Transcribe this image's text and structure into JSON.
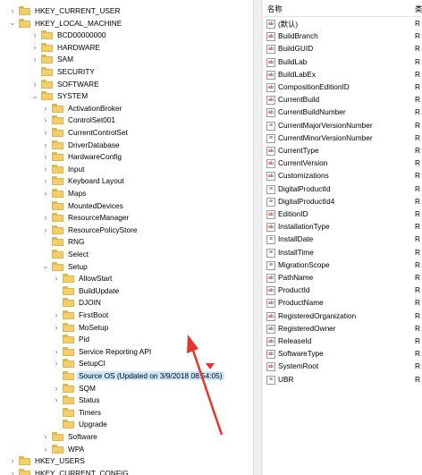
{
  "tree": [
    {
      "label": "HKEY_CURRENT_USER",
      "level": 0,
      "exp": ">",
      "name": "tree-item-hkey-current-user"
    },
    {
      "label": "HKEY_LOCAL_MACHINE",
      "level": 0,
      "exp": "v",
      "name": "tree-item-hkey-local-machine"
    },
    {
      "label": "BCD00000000",
      "level": 1,
      "exp": ">",
      "name": "tree-item-bcd00000000"
    },
    {
      "label": "HARDWARE",
      "level": 1,
      "exp": ">",
      "name": "tree-item-hardware"
    },
    {
      "label": "SAM",
      "level": 1,
      "exp": ">",
      "name": "tree-item-sam"
    },
    {
      "label": "SECURITY",
      "level": 1,
      "exp": "",
      "name": "tree-item-security"
    },
    {
      "label": "SOFTWARE",
      "level": 1,
      "exp": ">",
      "name": "tree-item-software"
    },
    {
      "label": "SYSTEM",
      "level": 1,
      "exp": "v",
      "name": "tree-item-system"
    },
    {
      "label": "ActivationBroker",
      "level": 2,
      "exp": ">",
      "name": "tree-item-activationbroker"
    },
    {
      "label": "ControlSet001",
      "level": 2,
      "exp": ">",
      "name": "tree-item-controlset001"
    },
    {
      "label": "CurrentControlSet",
      "level": 2,
      "exp": ">",
      "name": "tree-item-currentcontrolset"
    },
    {
      "label": "DriverDatabase",
      "level": 2,
      "exp": ">",
      "name": "tree-item-driverdatabase"
    },
    {
      "label": "HardwareConfig",
      "level": 2,
      "exp": ">",
      "name": "tree-item-hardwareconfig"
    },
    {
      "label": "Input",
      "level": 2,
      "exp": ">",
      "name": "tree-item-input"
    },
    {
      "label": "Keyboard Layout",
      "level": 2,
      "exp": ">",
      "name": "tree-item-keyboard-layout"
    },
    {
      "label": "Maps",
      "level": 2,
      "exp": ">",
      "name": "tree-item-maps"
    },
    {
      "label": "MountedDevices",
      "level": 2,
      "exp": "",
      "name": "tree-item-mounteddevices"
    },
    {
      "label": "ResourceManager",
      "level": 2,
      "exp": ">",
      "name": "tree-item-resourcemanager"
    },
    {
      "label": "ResourcePolicyStore",
      "level": 2,
      "exp": ">",
      "name": "tree-item-resourcepolicystore"
    },
    {
      "label": "RNG",
      "level": 2,
      "exp": "",
      "name": "tree-item-rng"
    },
    {
      "label": "Select",
      "level": 2,
      "exp": "",
      "name": "tree-item-select"
    },
    {
      "label": "Setup",
      "level": 2,
      "exp": "v",
      "name": "tree-item-setup"
    },
    {
      "label": "AllowStart",
      "level": 3,
      "exp": ">",
      "name": "tree-item-allowstart"
    },
    {
      "label": "BuildUpdate",
      "level": 3,
      "exp": "",
      "name": "tree-item-buildupdate"
    },
    {
      "label": "DJOIN",
      "level": 3,
      "exp": "",
      "name": "tree-item-djoin"
    },
    {
      "label": "FirstBoot",
      "level": 3,
      "exp": ">",
      "name": "tree-item-firstboot"
    },
    {
      "label": "MoSetup",
      "level": 3,
      "exp": ">",
      "name": "tree-item-mosetup"
    },
    {
      "label": "Pid",
      "level": 3,
      "exp": "",
      "name": "tree-item-pid"
    },
    {
      "label": "Service Reporting API",
      "level": 3,
      "exp": ">",
      "name": "tree-item-service-reporting-api"
    },
    {
      "label": "SetupCl",
      "level": 3,
      "exp": ">",
      "name": "tree-item-setupcl"
    },
    {
      "label": "Source OS (Updated on 3/9/2018 08:54:05)",
      "level": 3,
      "exp": "",
      "selected": true,
      "name": "tree-item-source-os"
    },
    {
      "label": "SQM",
      "level": 3,
      "exp": ">",
      "name": "tree-item-sqm"
    },
    {
      "label": "Status",
      "level": 3,
      "exp": ">",
      "name": "tree-item-status"
    },
    {
      "label": "Timers",
      "level": 3,
      "exp": "",
      "name": "tree-item-timers"
    },
    {
      "label": "Upgrade",
      "level": 3,
      "exp": "",
      "name": "tree-item-upgrade"
    },
    {
      "label": "Software",
      "level": 2,
      "exp": ">",
      "name": "tree-item-software-2"
    },
    {
      "label": "WPA",
      "level": 2,
      "exp": ">",
      "name": "tree-item-wpa"
    },
    {
      "label": "HKEY_USERS",
      "level": 0,
      "exp": ">",
      "name": "tree-item-hkey-users"
    },
    {
      "label": "HKEY_CURRENT_CONFIG",
      "level": 0,
      "exp": ">",
      "name": "tree-item-hkey-current-config"
    }
  ],
  "values_header": {
    "name": "名称",
    "type": "类"
  },
  "values": [
    {
      "name": "(默认)",
      "icon": "ab",
      "type": "R"
    },
    {
      "name": "BuildBranch",
      "icon": "ab",
      "type": "R"
    },
    {
      "name": "BuildGUID",
      "icon": "ab",
      "type": "R"
    },
    {
      "name": "BuildLab",
      "icon": "ab",
      "type": "R"
    },
    {
      "name": "BuildLabEx",
      "icon": "ab",
      "type": "R"
    },
    {
      "name": "CompositionEditionID",
      "icon": "ab",
      "type": "R"
    },
    {
      "name": "CurrentBuild",
      "icon": "ab",
      "type": "R"
    },
    {
      "name": "CurrentBuildNumber",
      "icon": "ab",
      "type": "R"
    },
    {
      "name": "CurrentMajorVersionNumber",
      "icon": "bin",
      "type": "R"
    },
    {
      "name": "CurrentMinorVersionNumber",
      "icon": "bin",
      "type": "R"
    },
    {
      "name": "CurrentType",
      "icon": "ab",
      "type": "R"
    },
    {
      "name": "CurrentVersion",
      "icon": "ab",
      "type": "R"
    },
    {
      "name": "Customizations",
      "icon": "ab",
      "type": "R"
    },
    {
      "name": "DigitalProductId",
      "icon": "bin",
      "type": "R"
    },
    {
      "name": "DigitalProductId4",
      "icon": "bin",
      "type": "R"
    },
    {
      "name": "EditionID",
      "icon": "ab",
      "type": "R"
    },
    {
      "name": "InstallationType",
      "icon": "ab",
      "type": "R"
    },
    {
      "name": "InstallDate",
      "icon": "bin",
      "type": "R"
    },
    {
      "name": "InstallTime",
      "icon": "bin",
      "type": "R"
    },
    {
      "name": "MigrationScope",
      "icon": "bin",
      "type": "R"
    },
    {
      "name": "PathName",
      "icon": "ab",
      "type": "R"
    },
    {
      "name": "ProductId",
      "icon": "ab",
      "type": "R"
    },
    {
      "name": "ProductName",
      "icon": "ab",
      "type": "R"
    },
    {
      "name": "RegisteredOrganization",
      "icon": "ab",
      "type": "R"
    },
    {
      "name": "RegisteredOwner",
      "icon": "ab",
      "type": "R"
    },
    {
      "name": "ReleaseId",
      "icon": "ab",
      "type": "R"
    },
    {
      "name": "SoftwareType",
      "icon": "ab",
      "type": "R"
    },
    {
      "name": "SystemRoot",
      "icon": "ab",
      "type": "R"
    },
    {
      "name": "UBR",
      "icon": "bin",
      "type": "R"
    }
  ],
  "annotation": {
    "arrow_color": "#e8352b",
    "arrow_icon": "red-arrow-annotation"
  },
  "colors": {
    "selection": "#cce8ff",
    "folder": "#f3cf6c"
  }
}
